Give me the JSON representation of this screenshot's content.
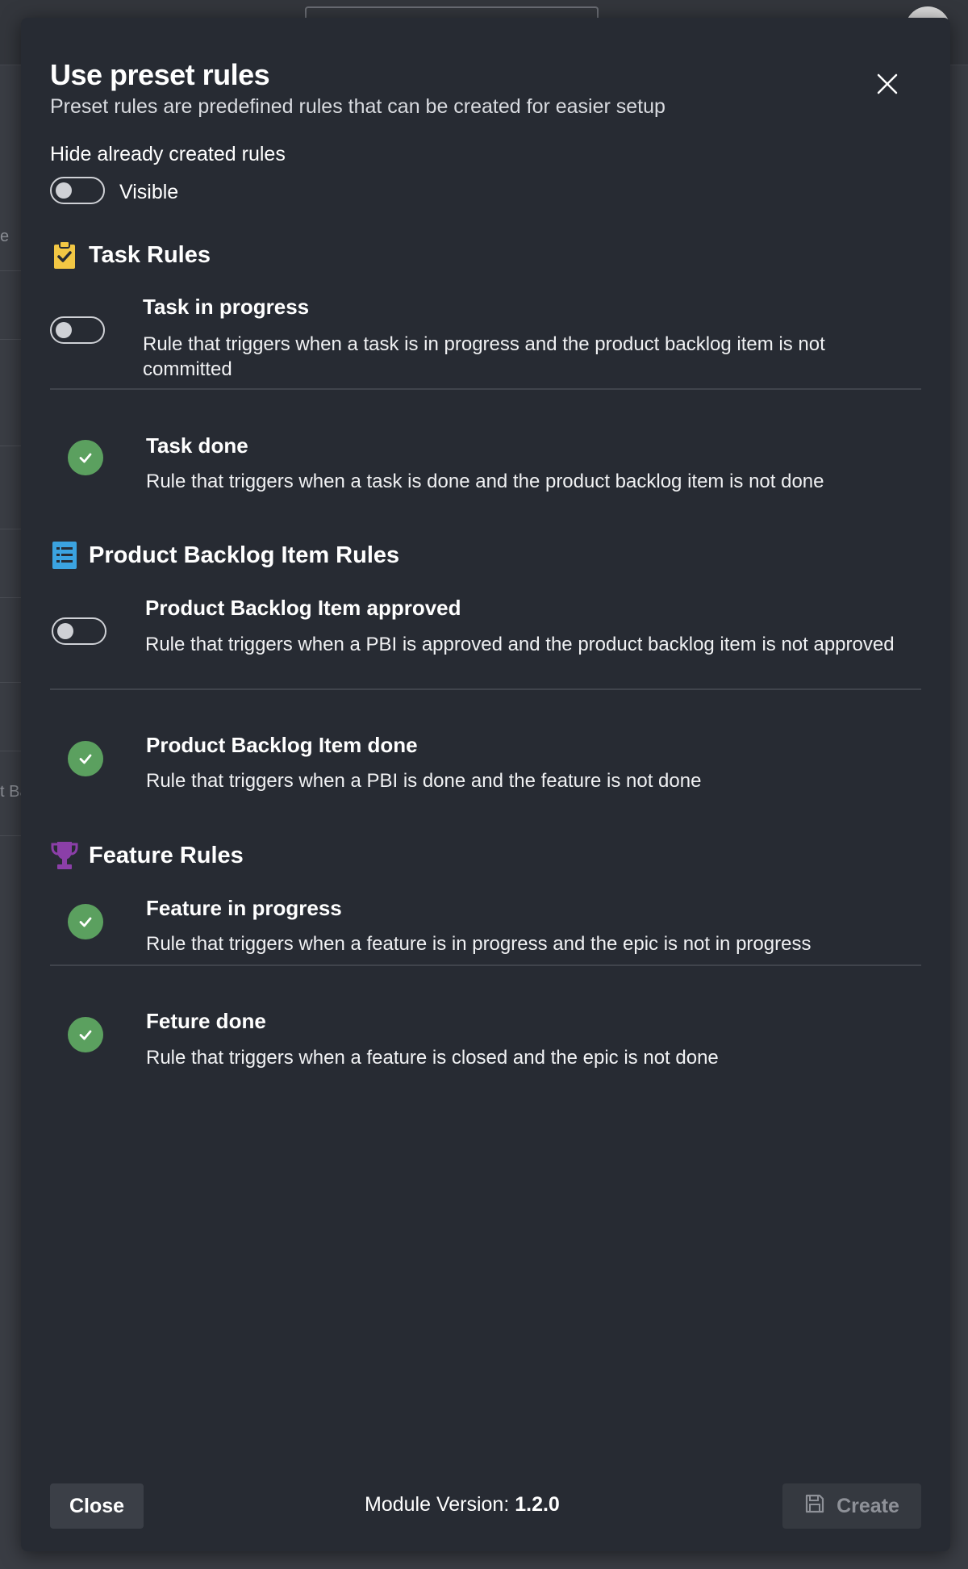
{
  "background": {
    "fragment_1": "e",
    "fragment_2": "t Ba"
  },
  "modal": {
    "title": "Use preset rules",
    "subtitle": "Preset rules are predefined rules that can be created for easier setup",
    "hide_label": "Hide already created rules",
    "visibility_toggle": {
      "state": "off",
      "label": "Visible"
    },
    "close_icon": "close-icon"
  },
  "sections": [
    {
      "title": "Task Rules",
      "icon": "clipboard-check-icon",
      "icon_color": "#f2c744",
      "rules": [
        {
          "title": "Task in progress",
          "description": "Rule that triggers when a task is in progress and the product backlog item is not committed",
          "status": "toggle-off"
        },
        {
          "title": "Task done",
          "description": "Rule that triggers when a task is done and the product backlog item is not done",
          "status": "created"
        }
      ]
    },
    {
      "title": "Product Backlog Item Rules",
      "icon": "list-document-icon",
      "icon_color": "#3ba3e0",
      "rules": [
        {
          "title": "Product Backlog Item approved",
          "description": "Rule that triggers when a PBI is approved and the product backlog item is not approved",
          "status": "toggle-off"
        },
        {
          "title": "Product Backlog Item done",
          "description": "Rule that triggers when a PBI is done and the feature is not done",
          "status": "created"
        }
      ]
    },
    {
      "title": "Feature Rules",
      "icon": "trophy-icon",
      "icon_color": "#8b3fa8",
      "rules": [
        {
          "title": "Feature in progress",
          "description": "Rule that triggers when a feature is in progress and the epic is not in progress",
          "status": "created"
        },
        {
          "title": "Feture done",
          "description": "Rule that triggers when a feature is closed and the epic is not done",
          "status": "created"
        }
      ]
    }
  ],
  "footer": {
    "close_label": "Close",
    "version_label": "Module Version:",
    "version_value": "1.2.0",
    "create_label": "Create",
    "create_icon": "save-icon"
  },
  "colors": {
    "modal_bg": "#272b33",
    "check_green": "#5ba05f",
    "toggle_border": "#cfd1d6"
  }
}
